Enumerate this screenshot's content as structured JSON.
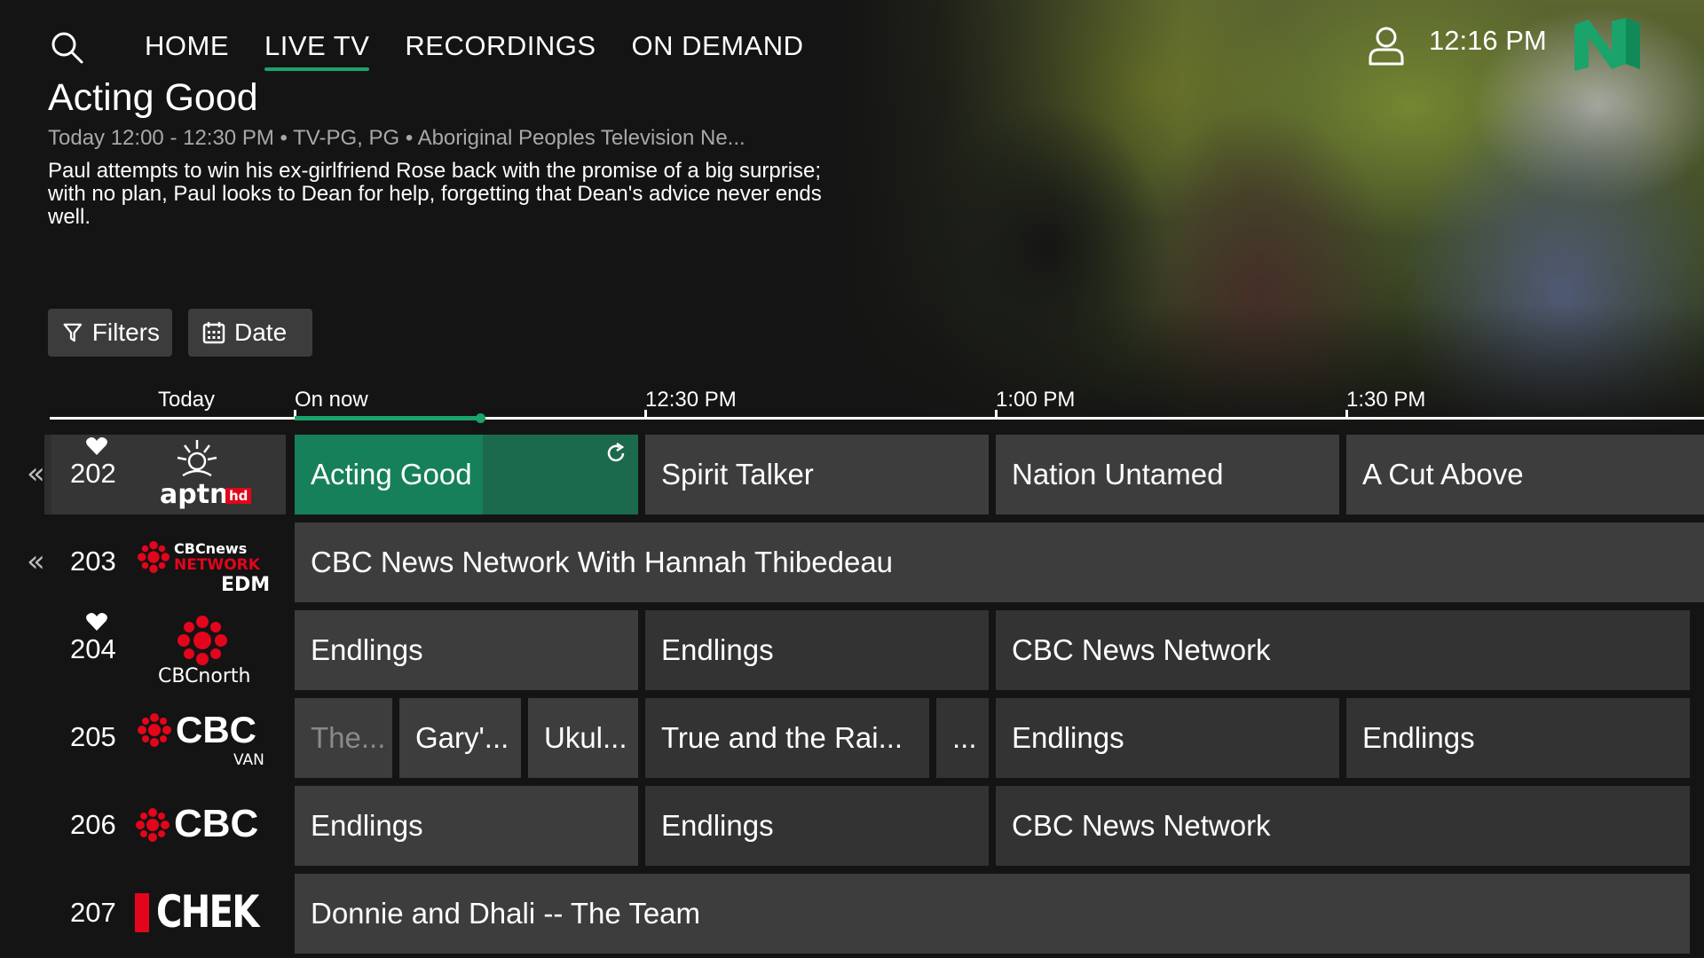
{
  "nav": {
    "tabs": [
      {
        "label": "HOME"
      },
      {
        "label": "LIVE TV"
      },
      {
        "label": "RECORDINGS"
      },
      {
        "label": "ON DEMAND"
      }
    ],
    "active_tab": "LIVE TV",
    "clock": "12:16 PM"
  },
  "program": {
    "title": "Acting Good",
    "meta": "Today 12:00 - 12:30 PM • TV-PG, PG • Aboriginal Peoples Television Ne...",
    "description": "Paul attempts to win his ex-girlfriend Rose back with the promise of a big surprise; with no plan, Paul looks to Dean for help, forgetting that Dean's advice never ends well."
  },
  "buttons": {
    "filters": "Filters",
    "date": "Date"
  },
  "timebar": {
    "today": "Today",
    "slots": [
      "On now",
      "12:30 PM",
      "1:00 PM",
      "1:30 PM"
    ],
    "progress_fraction": 0.53
  },
  "channels": [
    {
      "number": "202",
      "favorite": true,
      "back": true,
      "logo": "aptn-hd-logo",
      "logo_text": "aptn",
      "logo_badge": "hd",
      "programs": [
        "Acting Good",
        "Spirit Talker",
        "Nation Untamed",
        "A Cut Above"
      ]
    },
    {
      "number": "203",
      "favorite": false,
      "back": true,
      "logo": "cbc-news-network-logo",
      "logo_text": "CBCnews",
      "logo_line2": "NETWORK",
      "logo_line3": "EDM",
      "programs": [
        "CBC News Network With Hannah Thibedeau"
      ]
    },
    {
      "number": "204",
      "favorite": true,
      "back": false,
      "logo": "cbc-north-logo",
      "logo_text": "CBCnorth",
      "programs": [
        "Endlings",
        "Endlings",
        "CBC News Network"
      ]
    },
    {
      "number": "205",
      "favorite": false,
      "back": false,
      "logo": "cbc-van-logo",
      "logo_text": "CBC",
      "logo_sub": "VAN",
      "programs": [
        "The...",
        "Gary'...",
        "Ukul...",
        "True and the Rai...",
        "...",
        "Endlings",
        "Endlings"
      ]
    },
    {
      "number": "206",
      "favorite": false,
      "back": false,
      "logo": "cbc-logo",
      "logo_text": "CBC",
      "programs": [
        "Endlings",
        "Endlings",
        "CBC News Network"
      ]
    },
    {
      "number": "207",
      "favorite": false,
      "back": false,
      "logo": "chek-logo",
      "logo_text": "CHEK",
      "programs": [
        "Donnie and Dhali -- The Team"
      ]
    }
  ],
  "colors": {
    "accent": "#1aa36a",
    "cbc_red": "#e3051b",
    "background": "#141414"
  },
  "icons": [
    "search-icon",
    "user-icon",
    "filter-icon",
    "calendar-icon",
    "heart-icon",
    "double-chevron-left-icon",
    "restart-icon"
  ]
}
